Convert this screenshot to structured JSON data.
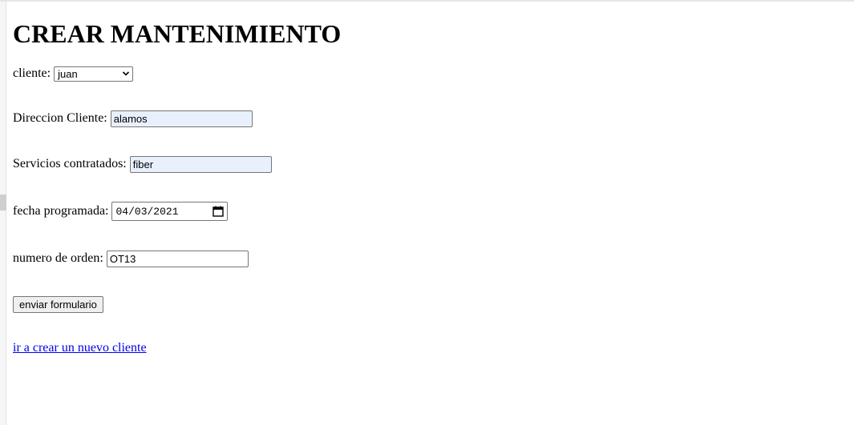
{
  "page": {
    "title": "CREAR MANTENIMIENTO"
  },
  "form": {
    "cliente": {
      "label": "cliente:",
      "selected": "juan",
      "icon": "chevron-down-icon"
    },
    "direccion": {
      "label": "Direccion Cliente:",
      "value": "alamos"
    },
    "servicios": {
      "label": "Servicios contratados:",
      "value": "fiber"
    },
    "fecha": {
      "label": "fecha programada:",
      "value": "04/03/2021",
      "icon": "calendar-icon"
    },
    "orden": {
      "label": "numero de orden:",
      "value": "OT13"
    },
    "submit_label": "enviar formulario"
  },
  "links": {
    "nuevo_cliente": "ir a crear un nuevo cliente"
  },
  "colors": {
    "autofill_bg": "#e8f0fe",
    "link": "#0000ee",
    "button_bg": "#efefef"
  }
}
